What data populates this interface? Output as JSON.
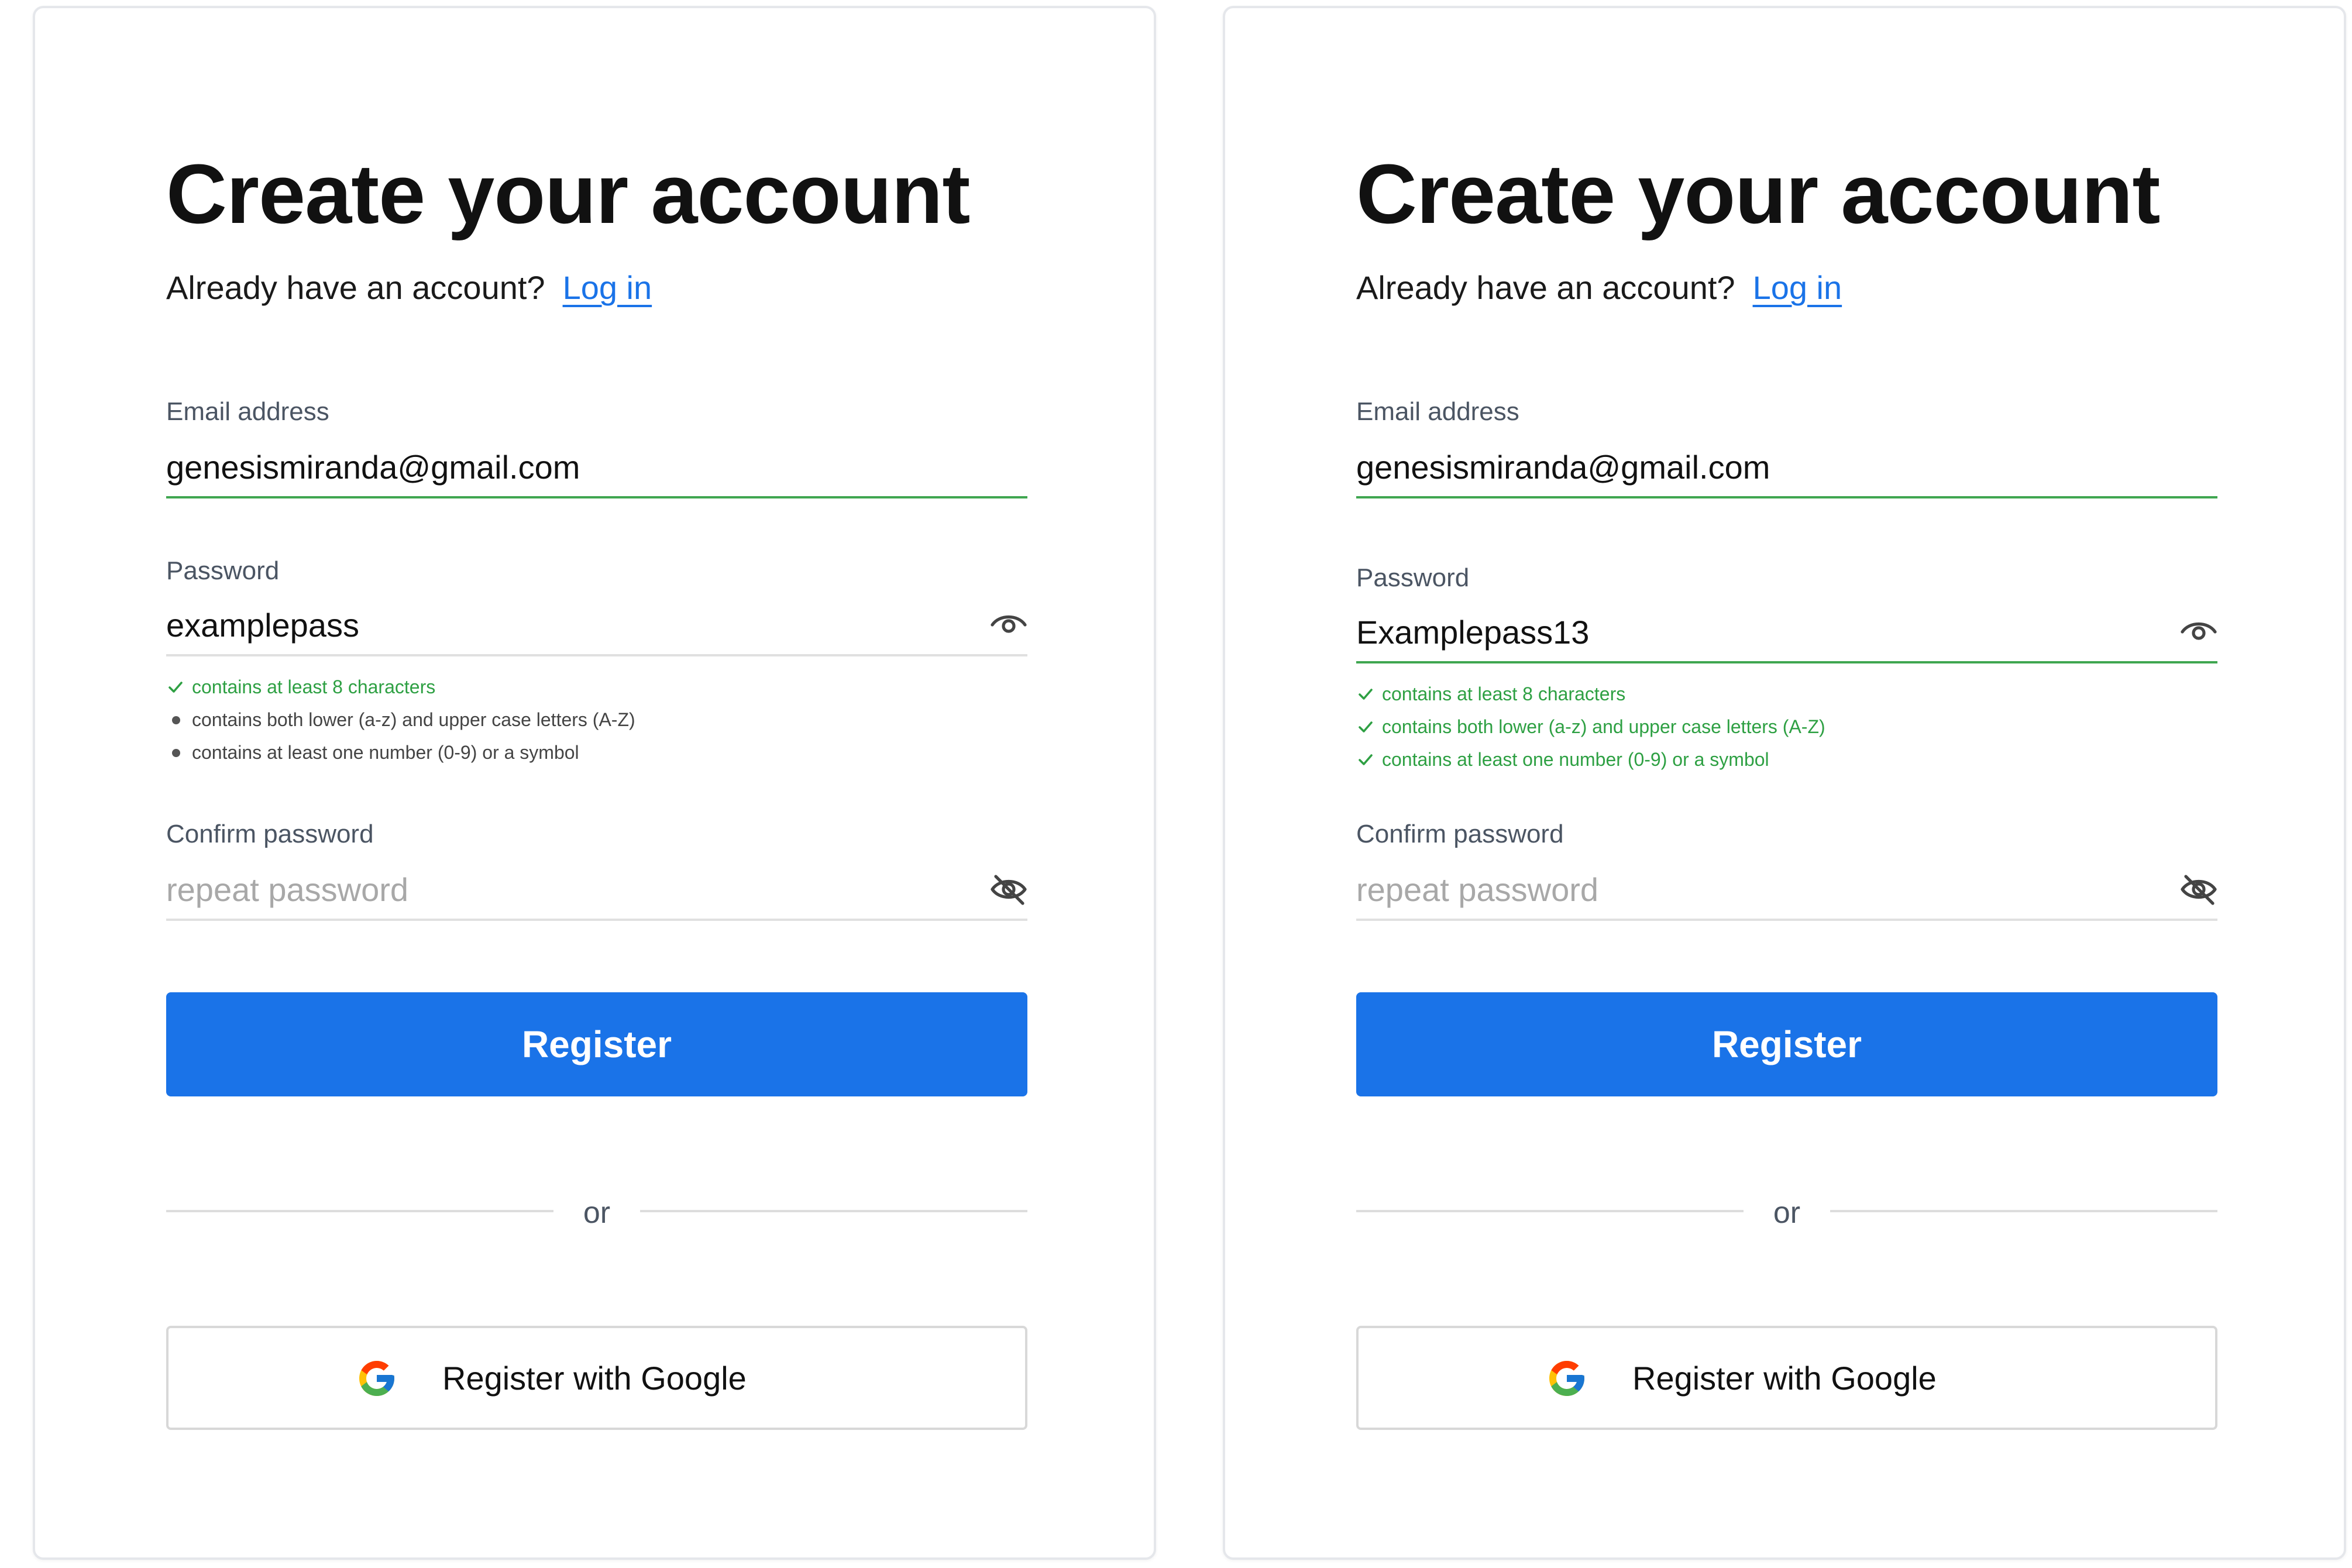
{
  "colors": {
    "primary": "#1a73e8",
    "valid": "#2ea043",
    "valid_underline": "#3fa650",
    "muted_text": "#4b5563",
    "placeholder": "#a8a8a8"
  },
  "left": {
    "title": "Create your account",
    "login_prompt": "Already have an account?",
    "login_link": "Log in",
    "email": {
      "label": "Email address",
      "value": "genesismiranda@gmail.com",
      "valid": true
    },
    "password": {
      "label": "Password",
      "value": "examplepass",
      "icon": "eye-icon",
      "valid": false
    },
    "rules": [
      {
        "text": "contains at least 8 characters",
        "met": true
      },
      {
        "text": "contains both lower (a-z) and upper case letters (A-Z)",
        "met": false
      },
      {
        "text": "contains at least one number (0-9) or a symbol",
        "met": false
      }
    ],
    "confirm": {
      "label": "Confirm password",
      "placeholder": "repeat password",
      "icon": "eye-slash-icon"
    },
    "register_label": "Register",
    "divider_text": "or",
    "google_label": "Register with Google"
  },
  "right": {
    "title": "Create your account",
    "login_prompt": "Already have an account?",
    "login_link": "Log in",
    "email": {
      "label": "Email address",
      "value": "genesismiranda@gmail.com",
      "valid": true
    },
    "password": {
      "label": "Password",
      "value": "Examplepass13",
      "icon": "eye-icon",
      "valid": true
    },
    "rules": [
      {
        "text": "contains at least 8 characters",
        "met": true
      },
      {
        "text": "contains both lower (a-z) and upper case letters (A-Z)",
        "met": true
      },
      {
        "text": "contains at least one number (0-9) or a symbol",
        "met": true
      }
    ],
    "confirm": {
      "label": "Confirm password",
      "placeholder": "repeat password",
      "icon": "eye-slash-icon"
    },
    "register_label": "Register",
    "divider_text": "or",
    "google_label": "Register with Google"
  }
}
